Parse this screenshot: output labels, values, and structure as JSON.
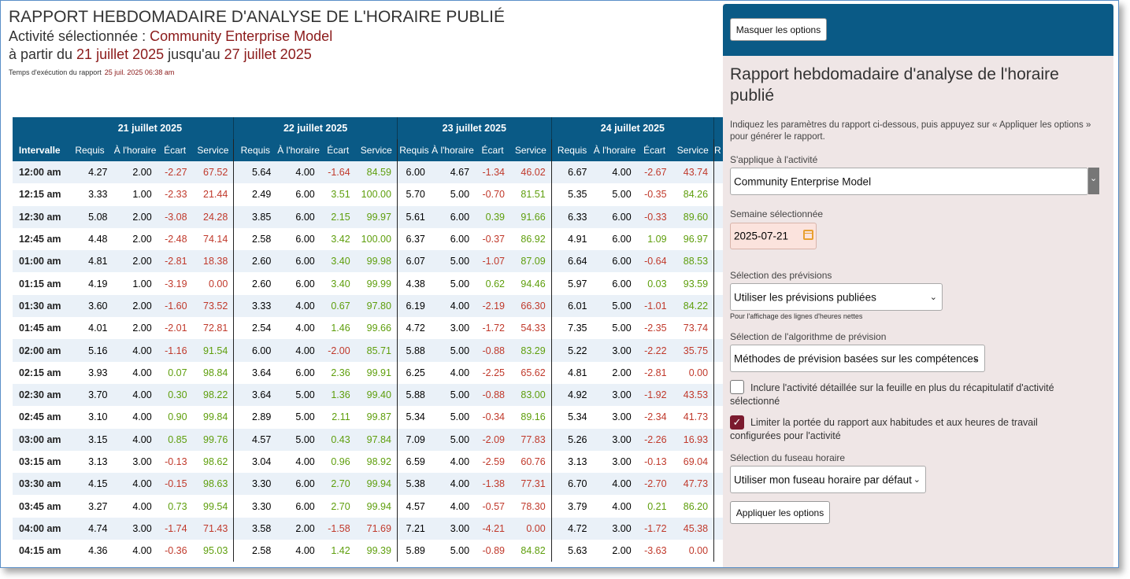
{
  "report": {
    "title": "RAPPORT HEBDOMADAIRE D'ANALYSE DE L'HORAIRE PUBLIÉ",
    "activity_prefix": "Activité sélectionnée : ",
    "activity": "Community Enterprise Model",
    "from_prefix": "à partir du ",
    "from_date": "21 juillet 2025",
    "to_prefix": " jusqu'au ",
    "to_date": "27 juillet 2025",
    "exec_label": "Temps d'exécution du rapport",
    "exec_time": "25 juil. 2025 06:38 am"
  },
  "table": {
    "days": [
      "21 juillet 2025",
      "22 juillet 2025",
      "23 juillet 2025",
      "24 juillet 2025"
    ],
    "interval_header": "Intervalle",
    "col_headers": [
      "Requis",
      "À l'horaire",
      "Écart",
      "Service"
    ],
    "clipped_header": "R",
    "rows": [
      {
        "t": "12:00 am",
        "d": [
          [
            "4.27",
            "2.00",
            "-2.27",
            "67.52"
          ],
          [
            "5.64",
            "4.00",
            "-1.64",
            "84.59"
          ],
          [
            "6.00",
            "4.67",
            "-1.34",
            "46.02"
          ],
          [
            "6.67",
            "4.00",
            "-2.67",
            "43.74"
          ]
        ]
      },
      {
        "t": "12:15 am",
        "d": [
          [
            "3.33",
            "1.00",
            "-2.33",
            "21.44"
          ],
          [
            "2.49",
            "6.00",
            "3.51",
            "100.00"
          ],
          [
            "5.70",
            "5.00",
            "-0.70",
            "81.51"
          ],
          [
            "5.35",
            "5.00",
            "-0.35",
            "84.26"
          ]
        ]
      },
      {
        "t": "12:30 am",
        "d": [
          [
            "5.08",
            "2.00",
            "-3.08",
            "24.28"
          ],
          [
            "3.85",
            "6.00",
            "2.15",
            "99.97"
          ],
          [
            "5.61",
            "6.00",
            "0.39",
            "91.66"
          ],
          [
            "6.33",
            "6.00",
            "-0.33",
            "89.60"
          ]
        ]
      },
      {
        "t": "12:45 am",
        "d": [
          [
            "4.48",
            "2.00",
            "-2.48",
            "74.14"
          ],
          [
            "2.58",
            "6.00",
            "3.42",
            "100.00"
          ],
          [
            "6.37",
            "6.00",
            "-0.37",
            "86.92"
          ],
          [
            "4.91",
            "6.00",
            "1.09",
            "96.97"
          ]
        ]
      },
      {
        "t": "01:00 am",
        "d": [
          [
            "4.81",
            "2.00",
            "-2.81",
            "18.38"
          ],
          [
            "2.60",
            "6.00",
            "3.40",
            "99.98"
          ],
          [
            "6.07",
            "5.00",
            "-1.07",
            "87.09"
          ],
          [
            "6.64",
            "6.00",
            "-0.64",
            "88.53"
          ]
        ]
      },
      {
        "t": "01:15 am",
        "d": [
          [
            "4.19",
            "1.00",
            "-3.19",
            "0.00"
          ],
          [
            "2.60",
            "6.00",
            "3.40",
            "99.99"
          ],
          [
            "4.38",
            "5.00",
            "0.62",
            "94.46"
          ],
          [
            "5.97",
            "6.00",
            "0.03",
            "93.59"
          ]
        ]
      },
      {
        "t": "01:30 am",
        "d": [
          [
            "3.60",
            "2.00",
            "-1.60",
            "73.52"
          ],
          [
            "3.33",
            "4.00",
            "0.67",
            "97.80"
          ],
          [
            "6.19",
            "4.00",
            "-2.19",
            "66.30"
          ],
          [
            "6.01",
            "5.00",
            "-1.01",
            "84.22"
          ]
        ]
      },
      {
        "t": "01:45 am",
        "d": [
          [
            "4.01",
            "2.00",
            "-2.01",
            "72.81"
          ],
          [
            "2.54",
            "4.00",
            "1.46",
            "99.66"
          ],
          [
            "4.72",
            "3.00",
            "-1.72",
            "54.33"
          ],
          [
            "7.35",
            "5.00",
            "-2.35",
            "73.74"
          ]
        ]
      },
      {
        "t": "02:00 am",
        "d": [
          [
            "5.16",
            "4.00",
            "-1.16",
            "91.54"
          ],
          [
            "6.00",
            "4.00",
            "-2.00",
            "85.71"
          ],
          [
            "5.88",
            "5.00",
            "-0.88",
            "83.29"
          ],
          [
            "5.22",
            "3.00",
            "-2.22",
            "35.75"
          ]
        ]
      },
      {
        "t": "02:15 am",
        "d": [
          [
            "3.93",
            "4.00",
            "0.07",
            "98.84"
          ],
          [
            "3.64",
            "6.00",
            "2.36",
            "99.91"
          ],
          [
            "6.25",
            "4.00",
            "-2.25",
            "65.62"
          ],
          [
            "4.81",
            "2.00",
            "-2.81",
            "0.00"
          ]
        ]
      },
      {
        "t": "02:30 am",
        "d": [
          [
            "3.70",
            "4.00",
            "0.30",
            "98.22"
          ],
          [
            "3.64",
            "5.00",
            "1.36",
            "99.40"
          ],
          [
            "5.88",
            "5.00",
            "-0.88",
            "83.00"
          ],
          [
            "4.92",
            "3.00",
            "-1.92",
            "43.53"
          ]
        ]
      },
      {
        "t": "02:45 am",
        "d": [
          [
            "3.10",
            "4.00",
            "0.90",
            "99.84"
          ],
          [
            "2.89",
            "5.00",
            "2.11",
            "99.87"
          ],
          [
            "5.34",
            "5.00",
            "-0.34",
            "89.16"
          ],
          [
            "5.34",
            "3.00",
            "-2.34",
            "41.73"
          ]
        ]
      },
      {
        "t": "03:00 am",
        "d": [
          [
            "3.15",
            "4.00",
            "0.85",
            "99.76"
          ],
          [
            "4.57",
            "5.00",
            "0.43",
            "97.84"
          ],
          [
            "7.09",
            "5.00",
            "-2.09",
            "77.83"
          ],
          [
            "5.26",
            "3.00",
            "-2.26",
            "16.93"
          ]
        ]
      },
      {
        "t": "03:15 am",
        "d": [
          [
            "3.13",
            "3.00",
            "-0.13",
            "98.62"
          ],
          [
            "3.04",
            "4.00",
            "0.96",
            "98.92"
          ],
          [
            "6.59",
            "4.00",
            "-2.59",
            "60.76"
          ],
          [
            "3.13",
            "3.00",
            "-0.13",
            "69.04"
          ]
        ]
      },
      {
        "t": "03:30 am",
        "d": [
          [
            "4.15",
            "4.00",
            "-0.15",
            "98.63"
          ],
          [
            "3.30",
            "6.00",
            "2.70",
            "99.94"
          ],
          [
            "5.38",
            "4.00",
            "-1.38",
            "77.31"
          ],
          [
            "6.70",
            "4.00",
            "-2.70",
            "47.73"
          ]
        ]
      },
      {
        "t": "03:45 am",
        "d": [
          [
            "3.27",
            "4.00",
            "0.73",
            "99.54"
          ],
          [
            "3.30",
            "6.00",
            "2.70",
            "99.94"
          ],
          [
            "4.57",
            "4.00",
            "-0.57",
            "78.30"
          ],
          [
            "3.79",
            "4.00",
            "0.21",
            "86.20"
          ]
        ]
      },
      {
        "t": "04:00 am",
        "d": [
          [
            "4.74",
            "3.00",
            "-1.74",
            "71.43"
          ],
          [
            "3.58",
            "2.00",
            "-1.58",
            "71.69"
          ],
          [
            "7.21",
            "3.00",
            "-4.21",
            "0.00"
          ],
          [
            "4.72",
            "3.00",
            "-1.72",
            "45.38"
          ]
        ]
      },
      {
        "t": "04:15 am",
        "d": [
          [
            "4.36",
            "4.00",
            "-0.36",
            "95.03"
          ],
          [
            "2.58",
            "4.00",
            "1.42",
            "99.39"
          ],
          [
            "5.89",
            "5.00",
            "-0.89",
            "84.82"
          ],
          [
            "5.63",
            "2.00",
            "-3.63",
            "0.00"
          ]
        ]
      }
    ]
  },
  "panel": {
    "hide_button": "Masquer les options",
    "title": "Rapport hebdomadaire d'analyse de l'horaire publié",
    "description": "Indiquez les paramètres du rapport ci-dessous, puis appuyez sur « Appliquer les options » pour générer le rapport.",
    "activity_label": "S'applique à l'activité",
    "activity_value": "Community Enterprise Model",
    "week_label": "Semaine sélectionnée",
    "week_value": "2025-07-21",
    "forecast_label": "Sélection des prévisions",
    "forecast_value": "Utiliser les prévisions publiées",
    "forecast_note": "Pour l'affichage des lignes d'heures nettes",
    "algo_label": "Sélection de l'algorithme de prévision",
    "algo_value": "Méthodes de prévision basées sur les compétences",
    "include_detail_label": "Inclure l'activité détaillée sur la feuille en plus du récapitulatif d'activité sélectionné",
    "include_detail_checked": false,
    "limit_scope_label": "Limiter la portée du rapport aux habitudes et aux heures de travail configurées pour l'activité",
    "limit_scope_checked": true,
    "tz_label": "Sélection du fuseau horaire",
    "tz_value": "Utiliser mon fuseau horaire par défaut",
    "apply_button": "Appliquer les options"
  },
  "colors": {
    "header_bg": "#0a5a86",
    "highlight": "#8b1a1a",
    "negative": "#c0392b",
    "positive": "#5e9e0c",
    "panel_bg": "#efe6e6",
    "checkbox_on": "#7b1a2e"
  }
}
